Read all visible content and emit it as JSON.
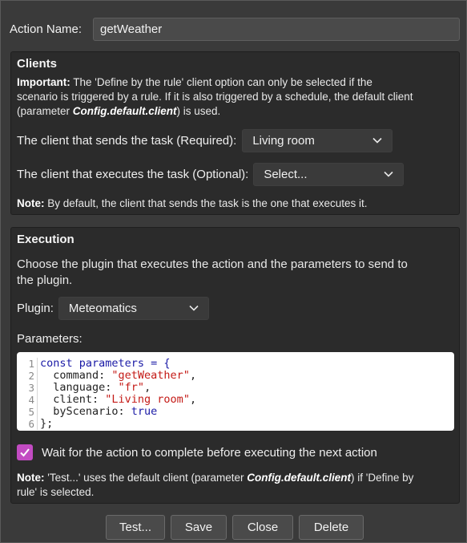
{
  "action_name": {
    "label": "Action Name:",
    "value": "getWeather"
  },
  "clients": {
    "title": "Clients",
    "important_label": "Important:",
    "important_line1": " The 'Define by the rule' client option can only be selected if the",
    "important_line2": "scenario is triggered by a rule. If it is also triggered by a schedule, the default client",
    "important_line3a": "(parameter ",
    "important_param": "Config.default.client",
    "important_line3b": ") is used.",
    "sender_label": "The client that sends the task (Required):",
    "sender_value": "Living room",
    "executor_label": "The client that executes the task (Optional):",
    "executor_value": "Select...",
    "note_label": "Note:",
    "note_text": " By default, the client that sends the task is the one that executes it."
  },
  "execution": {
    "title": "Execution",
    "description_line1": "Choose the plugin that executes the action and the parameters to send to",
    "description_line2": "the plugin.",
    "plugin_label": "Plugin:",
    "plugin_value": "Meteomatics",
    "parameters_label": "Parameters:",
    "code_line_numbers": [
      "1",
      "2",
      "3",
      "4",
      "5",
      "6"
    ],
    "code": {
      "l1_kw": "const",
      "l1_rest": " parameters = {",
      "l2_key": "  command: ",
      "l2_val": "\"getWeather\"",
      "l2_end": ",",
      "l3_key": "  language: ",
      "l3_val": "\"fr\"",
      "l3_end": ",",
      "l4_key": "  client: ",
      "l4_val": "\"Living room\"",
      "l4_end": ",",
      "l5_key": "  byScenario: ",
      "l5_val": "true",
      "l6": "};"
    },
    "wait_checked": true,
    "wait_label": "Wait for the action to complete before executing the next action",
    "note_label": "Note:",
    "note_line1a": " 'Test...' uses the default client (parameter ",
    "note_param": "Config.default.client",
    "note_line1b": ") if 'Define by",
    "note_line2": "rule' is selected."
  },
  "buttons": {
    "test": "Test...",
    "save": "Save",
    "close": "Close",
    "delete": "Delete"
  },
  "colors": {
    "accent": "#c24bc2",
    "panel": "#2b2b2b",
    "background": "#3a3a3a"
  }
}
